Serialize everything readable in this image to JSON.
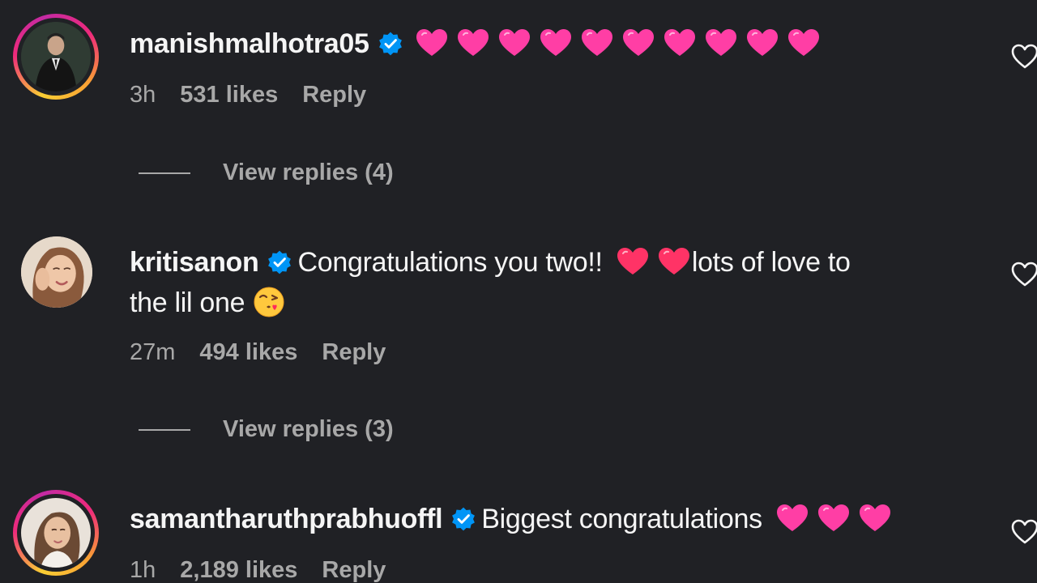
{
  "comments": [
    {
      "username": "manishmalhotra05",
      "text": "",
      "hearts": 10,
      "heart_color": "#ff3ea5",
      "time": "3h",
      "likes": "531 likes",
      "reply": "Reply",
      "view_replies": "View replies (4)",
      "story_ring": true
    },
    {
      "username": "kritisanon",
      "text_before": "Congratulations you two!!",
      "text_after": "lots of love to",
      "text_line2": "the lil one",
      "hearts": 2,
      "heart_color": "#ff3366",
      "time": "27m",
      "likes": "494 likes",
      "reply": "Reply",
      "view_replies": "View replies (3)",
      "story_ring": false
    },
    {
      "username": "samantharuthprabhuoffl",
      "text_before": "Biggest congratulations",
      "hearts": 3,
      "heart_color": "#ff3ea5",
      "time": "1h",
      "likes": "2,189 likes",
      "reply": "Reply",
      "story_ring": true
    }
  ],
  "icons": {
    "verified": "verified-badge-icon",
    "like": "heart-outline-icon",
    "heart_emoji": "pink-heart-emoji",
    "kiss_emoji": "face-blowing-kiss-emoji"
  },
  "colors": {
    "background": "#202125",
    "text": "#f5f5f5",
    "muted": "#a8a8a8",
    "verified": "#0095f6"
  }
}
